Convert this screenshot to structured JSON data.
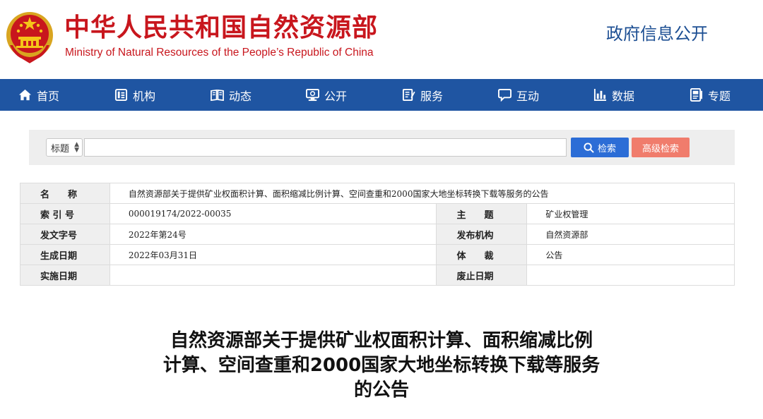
{
  "header": {
    "title_cn": "中华人民共和国自然资源部",
    "title_en": "Ministry of Natural Resources of the People’s Republic of China",
    "gov_info": "政府信息公开"
  },
  "nav": {
    "items": [
      {
        "label": "首页",
        "icon": "home-icon"
      },
      {
        "label": "机构",
        "icon": "org-icon"
      },
      {
        "label": "动态",
        "icon": "book-icon"
      },
      {
        "label": "公开",
        "icon": "monitor-icon"
      },
      {
        "label": "服务",
        "icon": "document-edit-icon"
      },
      {
        "label": "互动",
        "icon": "chat-icon"
      },
      {
        "label": "数据",
        "icon": "bar-chart-icon"
      },
      {
        "label": "专题",
        "icon": "topic-icon"
      }
    ]
  },
  "search": {
    "type_selected": "标题",
    "placeholder": "",
    "value": "",
    "search_label": "检索",
    "advanced_label": "高级检索"
  },
  "info": {
    "name_label": "名　　称",
    "name_value": "自然资源部关于提供矿业权面积计算、面积缩减比例计算、空间查重和2000国家大地坐标转换下载等服务的公告",
    "index_label": "索 引 号",
    "index_value": "000019174/2022-00035",
    "subject_label": "主　　题",
    "subject_value": "矿业权管理",
    "doc_no_label": "发文字号",
    "doc_no_value": "2022年第24号",
    "issuer_label": "发布机构",
    "issuer_value": "自然资源部",
    "created_label": "生成日期",
    "created_value": "2022年03月31日",
    "genre_label": "体　　裁",
    "genre_value": "公告",
    "effective_label": "实施日期",
    "effective_value": "",
    "abolish_label": "废止日期",
    "abolish_value": ""
  },
  "article": {
    "title_line1": "自然资源部关于提供矿业权面积计算、面积缩减比例",
    "title_line2": "计算、空间查重和2000国家大地坐标转换下载等服务",
    "title_line3": "的公告"
  },
  "colors": {
    "brand_red": "#c8161d",
    "nav_blue": "#1f55a2",
    "search_blue": "#2c6dd6",
    "advanced_salmon": "#f07c6c"
  }
}
